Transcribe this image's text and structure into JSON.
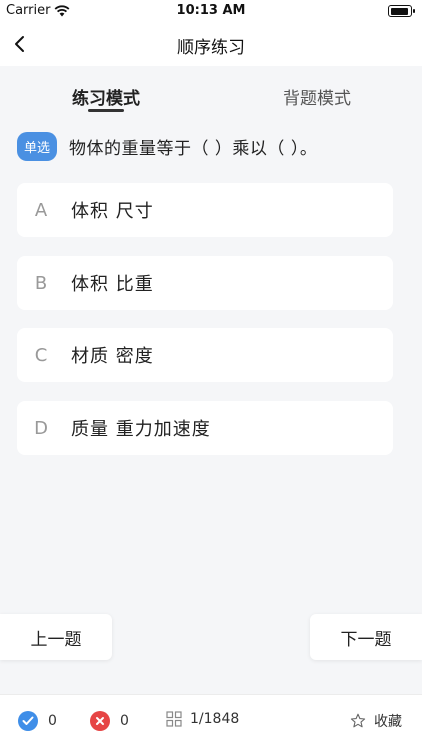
{
  "status_bar": {
    "carrier": "Carrier",
    "time": "10:13 AM",
    "wifi_icon": "wifi-icon",
    "battery_icon": "battery-icon"
  },
  "nav": {
    "back_icon": "chevron-left-icon",
    "title": "顺序练习"
  },
  "tabs": [
    {
      "label": "练习模式",
      "active": true
    },
    {
      "label": "背题模式",
      "active": false
    }
  ],
  "question": {
    "type_badge": "单选",
    "text": "物体的重量等于（ ）乘以（ ）。"
  },
  "options": [
    {
      "letter": "A",
      "text": "体积 尺寸"
    },
    {
      "letter": "B",
      "text": "体积 比重"
    },
    {
      "letter": "C",
      "text": "材质 密度"
    },
    {
      "letter": "D",
      "text": "质量 重力加速度"
    }
  ],
  "navigation": {
    "prev_label": "上一题",
    "next_label": "下一题"
  },
  "bottom_bar": {
    "correct_count": "0",
    "wrong_count": "0",
    "progress": "1/1848",
    "favorite_label": "收藏"
  },
  "colors": {
    "accent_blue": "#4a90e2",
    "correct_blue": "#3f8ee8",
    "wrong_red": "#e64545",
    "background": "#f5f6f8"
  }
}
